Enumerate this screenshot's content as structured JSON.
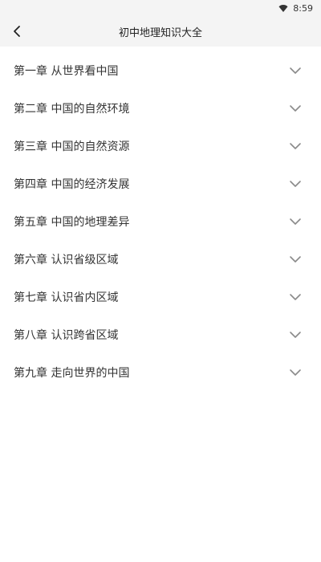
{
  "status_bar": {
    "time": "8:59",
    "wifi_icon": "wifi-icon"
  },
  "header": {
    "title": "初中地理知识大全",
    "back_icon": "chevron-left-icon"
  },
  "chapters": [
    {
      "label": "第一章 从世界看中国"
    },
    {
      "label": "第二章 中国的自然环境"
    },
    {
      "label": "第三章 中国的自然资源"
    },
    {
      "label": "第四章 中国的经济发展"
    },
    {
      "label": "第五章 中国的地理差异"
    },
    {
      "label": "第六章 认识省级区域"
    },
    {
      "label": "第七章 认识省内区域"
    },
    {
      "label": "第八章 认识跨省区域"
    },
    {
      "label": "第九章 走向世界的中国"
    }
  ],
  "colors": {
    "header_bg": "#f4f4f4",
    "text": "#333333",
    "chevron": "#8a8a8a"
  }
}
